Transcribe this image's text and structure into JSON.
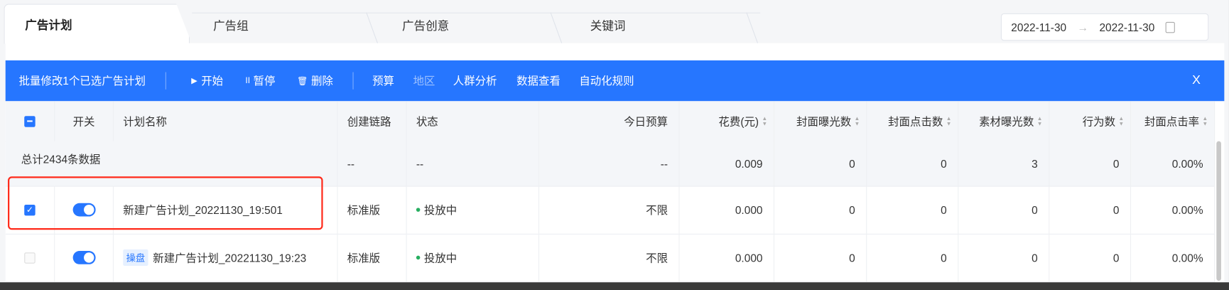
{
  "tabs": [
    "广告计划",
    "广告组",
    "广告创意",
    "关键词"
  ],
  "date_range": {
    "start": "2022-11-30",
    "end": "2022-11-30",
    "separator": "→"
  },
  "batch_bar": {
    "title": "批量修改1个已选广告计划",
    "start": "开始",
    "pause": "暂停",
    "delete": "删除",
    "budget": "预算",
    "region": "地区",
    "crowd": "人群分析",
    "data": "数据查看",
    "auto_rules": "自动化规则",
    "close": "X",
    "play_icon": "▶",
    "pause_icon": "II",
    "trash_icon": "🗑"
  },
  "table": {
    "headers": {
      "switch": "开关",
      "name": "计划名称",
      "chain": "创建链路",
      "status": "状态",
      "budget": "今日预算",
      "cost": "花费(元)",
      "cover_imp": "封面曝光数",
      "cover_click": "封面点击数",
      "material_imp": "素材曝光数",
      "actions": "行为数",
      "ctr": "封面点击率"
    },
    "summary": {
      "label": "总计2434条数据",
      "chain": "--",
      "status": "--",
      "budget": "--",
      "cost": "0.009",
      "cover_imp": "0",
      "cover_click": "0",
      "material_imp": "3",
      "actions": "0",
      "ctr": "0.00%"
    },
    "rows": [
      {
        "checked": true,
        "on": true,
        "tag": "",
        "name": "新建广告计划_20221130_19:501",
        "chain": "标准版",
        "status": "投放中",
        "budget": "不限",
        "cost": "0.000",
        "cover_imp": "0",
        "cover_click": "0",
        "material_imp": "0",
        "actions": "0",
        "ctr": "0.00%"
      },
      {
        "checked": false,
        "on": true,
        "tag": "操盘",
        "name": "新建广告计划_20221130_19:23",
        "chain": "标准版",
        "status": "投放中",
        "budget": "不限",
        "cost": "0.000",
        "cover_imp": "0",
        "cover_click": "0",
        "material_imp": "0",
        "actions": "0",
        "ctr": "0.00%"
      }
    ]
  },
  "colors": {
    "accent": "#2676ff",
    "highlight": "#ff2a1a",
    "status_dot": "#27ae60"
  }
}
